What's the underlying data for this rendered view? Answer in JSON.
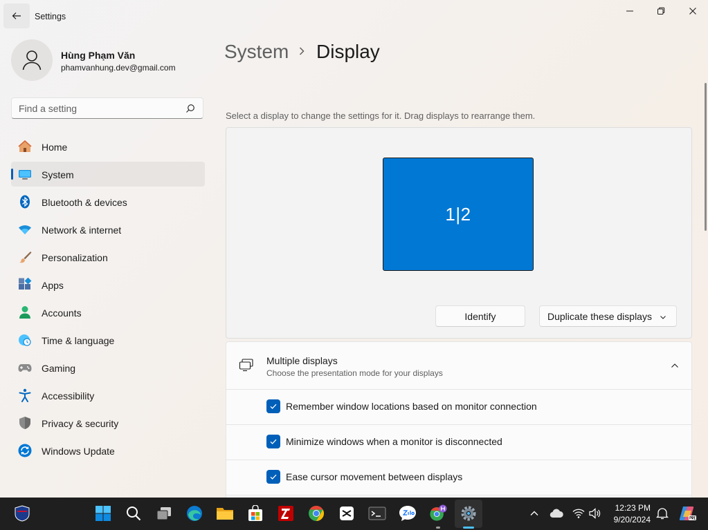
{
  "window": {
    "title": "Settings"
  },
  "profile": {
    "name": "Hùng Phạm Văn",
    "email": "phamvanhung.dev@gmail.com"
  },
  "search": {
    "placeholder": "Find a setting"
  },
  "nav": {
    "items": [
      {
        "label": "Home",
        "icon": "home-icon"
      },
      {
        "label": "System",
        "icon": "system-icon",
        "selected": true
      },
      {
        "label": "Bluetooth & devices",
        "icon": "bluetooth-icon"
      },
      {
        "label": "Network & internet",
        "icon": "wifi-icon"
      },
      {
        "label": "Personalization",
        "icon": "brush-icon"
      },
      {
        "label": "Apps",
        "icon": "apps-icon"
      },
      {
        "label": "Accounts",
        "icon": "accounts-icon"
      },
      {
        "label": "Time & language",
        "icon": "clock-globe-icon"
      },
      {
        "label": "Gaming",
        "icon": "gamepad-icon"
      },
      {
        "label": "Accessibility",
        "icon": "accessibility-icon"
      },
      {
        "label": "Privacy & security",
        "icon": "shield-icon"
      },
      {
        "label": "Windows Update",
        "icon": "update-icon"
      }
    ]
  },
  "header": {
    "parent": "System",
    "current": "Display"
  },
  "display": {
    "description": "Select a display to change the settings for it. Drag displays to rearrange them.",
    "monitor_label": "1|2",
    "identify_label": "Identify",
    "mode_select": "Duplicate these displays"
  },
  "multiple_displays": {
    "title": "Multiple displays",
    "subtitle": "Choose the presentation mode for your displays",
    "options": [
      {
        "label": "Remember window locations based on monitor connection",
        "checked": true
      },
      {
        "label": "Minimize windows when a monitor is disconnected",
        "checked": true
      },
      {
        "label": "Ease cursor movement between displays",
        "checked": true
      }
    ]
  },
  "taskbar": {
    "apps": [
      "nfl-icon",
      "start-icon",
      "search-icon",
      "task-view-icon",
      "edge-icon",
      "file-explorer-icon",
      "store-icon",
      "filezilla-icon",
      "chrome-icon",
      "capcut-icon",
      "terminal-icon",
      "zalo-icon",
      "chrome-profile-icon",
      "settings-icon"
    ],
    "time": "12:23 PM",
    "date": "9/20/2024"
  },
  "colors": {
    "accent": "#005fb8",
    "monitor": "#0078d4",
    "taskbar": "#1f1f1f"
  }
}
